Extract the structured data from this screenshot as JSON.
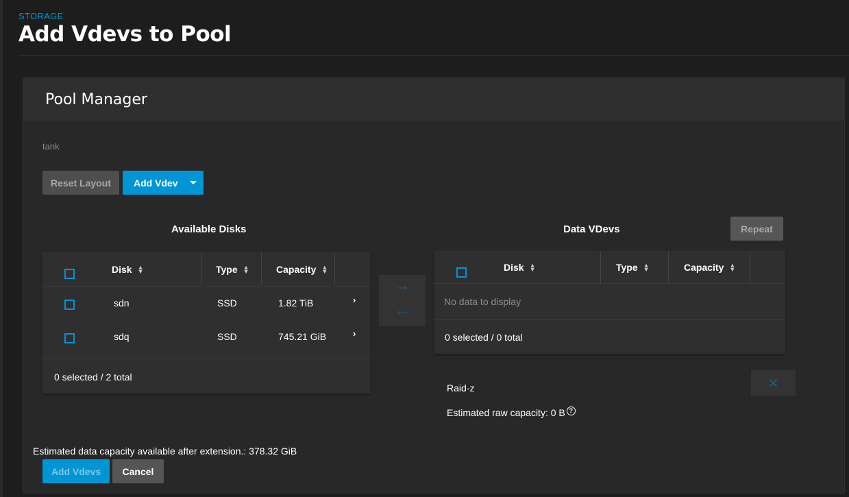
{
  "header": {
    "breadcrumb": "STORAGE",
    "title": "Add Vdevs to Pool"
  },
  "card": {
    "title": "Pool Manager",
    "pool_name": "tank"
  },
  "toolbar": {
    "reset_label": "Reset Layout",
    "add_vdev_label": "Add Vdev",
    "repeat_label": "Repeat"
  },
  "available": {
    "title": "Available Disks",
    "columns": [
      "Disk",
      "Type",
      "Capacity"
    ],
    "rows": [
      {
        "disk": "sdn",
        "type": "SSD",
        "capacity": "1.82 TiB"
      },
      {
        "disk": "sdq",
        "type": "SSD",
        "capacity": "745.21 GiB"
      }
    ],
    "footer": "0 selected / 2 total"
  },
  "data_vdevs": {
    "title": "Data VDevs",
    "columns": [
      "Disk",
      "Type",
      "Capacity"
    ],
    "empty": "No data to display",
    "footer": "0 selected / 0 total",
    "raid_type": "Raid-z",
    "raw_capacity": "Estimated raw capacity: 0 B"
  },
  "footer": {
    "estimate": "Estimated data capacity available after extension.: 378.32 GiB",
    "add_vdevs_label": "Add Vdevs",
    "cancel_label": "Cancel"
  },
  "colors": {
    "accent": "#0095d5",
    "background": "#1d1d1d",
    "card": "#282828"
  }
}
